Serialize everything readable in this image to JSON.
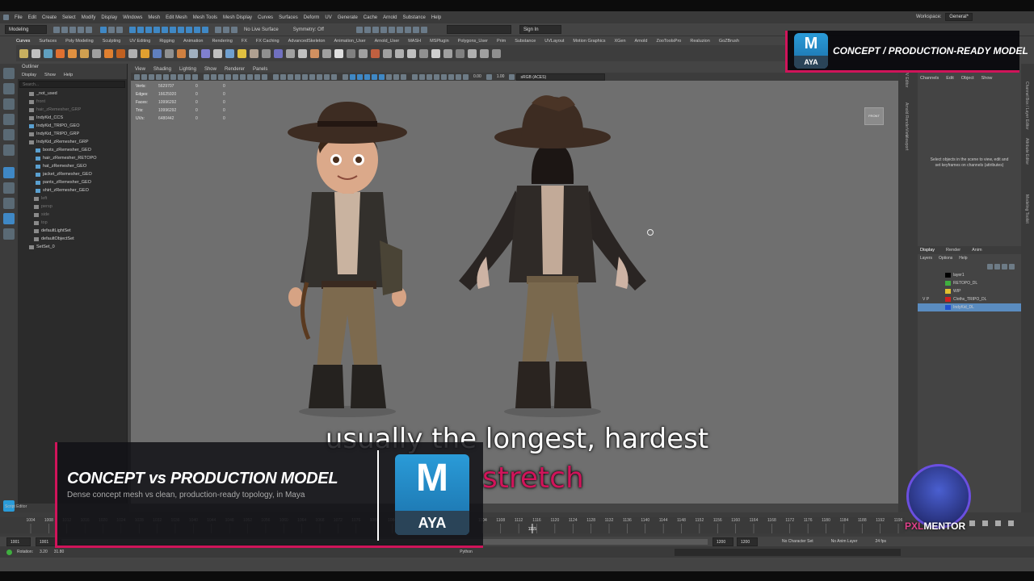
{
  "menubar": {
    "items": [
      "File",
      "Edit",
      "Create",
      "Select",
      "Modify",
      "Display",
      "Windows",
      "Mesh",
      "Edit Mesh",
      "Mesh Tools",
      "Mesh Display",
      "Curves",
      "Surfaces",
      "Deform",
      "UV",
      "Generate",
      "Cache",
      "Arnold",
      "Substance",
      "Help"
    ],
    "workspace_label": "Workspace:",
    "workspace_value": "General*"
  },
  "statusline": {
    "mode": "Modeling",
    "no_live_surface": "No Live Surface",
    "symmetry": "Symmetry: Off",
    "sign_in": "Sign In"
  },
  "shelf_tabs": [
    "Curves",
    "Surfaces",
    "Poly Modeling",
    "Sculpting",
    "UV Editing",
    "Rigging",
    "Animation",
    "Rendering",
    "FX",
    "FX Caching",
    "AdvancedSkeleton",
    "Animation_User",
    "Arnold_User",
    "MASH",
    "MSPlugin",
    "Polygons_User",
    "Prim",
    "Substance",
    "UVLayout",
    "Motion Graphics",
    "XGen",
    "Arnold",
    "ZooToolsPro",
    "Realuzion",
    "GoZBrush"
  ],
  "outliner": {
    "title": "Outliner",
    "menu": [
      "Display",
      "Show",
      "Help"
    ],
    "search_placeholder": "Search...",
    "nodes": [
      {
        "label": "_not_used",
        "dim": false
      },
      {
        "label": "front",
        "dim": true
      },
      {
        "label": "hair_zRemesher_GRP",
        "dim": true
      },
      {
        "label": "IndyKid_CCS",
        "dim": false
      },
      {
        "label": "IndyKid_TRIPO_GEO",
        "dim": false
      },
      {
        "label": "IndyKid_TRIPO_GRP",
        "dim": false
      },
      {
        "label": "IndyKid_zRemesher_GRP",
        "dim": false
      },
      {
        "label": "boots_zRemesher_GEO",
        "dim": false
      },
      {
        "label": "hair_zRemesher_RETOPO",
        "dim": false
      },
      {
        "label": "hat_zRemesher_GEO",
        "dim": false
      },
      {
        "label": "jacket_zRemesher_GEO",
        "dim": false
      },
      {
        "label": "pants_zRemesher_GEO",
        "dim": false
      },
      {
        "label": "shirt_zRemesher_GEO",
        "dim": false
      },
      {
        "label": "left",
        "dim": true
      },
      {
        "label": "persp",
        "dim": true
      },
      {
        "label": "side",
        "dim": true
      },
      {
        "label": "top",
        "dim": true
      },
      {
        "label": "defaultLightSet",
        "dim": false
      },
      {
        "label": "defaultObjectSet",
        "dim": false
      },
      {
        "label": "SetSet_0",
        "dim": false
      }
    ]
  },
  "viewport": {
    "menu": [
      "View",
      "Shading",
      "Lighting",
      "Show",
      "Renderer",
      "Panels"
    ],
    "exposure": "0.00",
    "gamma": "1.00",
    "color_space": "sRGB (ACES)",
    "view_cube": "FRONT",
    "hud": [
      {
        "k": "Verts:",
        "v": "5629707",
        "a": "0",
        "b": "0"
      },
      {
        "k": "Edges:",
        "v": "16625920",
        "a": "0",
        "b": "0"
      },
      {
        "k": "Faces:",
        "v": "10996292",
        "a": "0",
        "b": "0"
      },
      {
        "k": "Tris:",
        "v": "10996292",
        "a": "0",
        "b": "0"
      },
      {
        "k": "UVs:",
        "v": "6480442",
        "a": "0",
        "b": "0"
      }
    ]
  },
  "right_side_labels": [
    "UV Editor",
    "Arnold RenderView",
    "Viewport"
  ],
  "channel_box": {
    "menu": [
      "Channels",
      "Edit",
      "Object",
      "Show"
    ],
    "hint": "Select objects in the scene to view, edit and set keyframes on channels (attributes)"
  },
  "right_tabs": [
    "Channel Box / Layer Editor",
    "Attribute Editor",
    "Modeling Toolkit"
  ],
  "layers": {
    "tabs": [
      "Display",
      "Render",
      "Anim"
    ],
    "menu": [
      "Layers",
      "Options",
      "Help"
    ],
    "rows": [
      {
        "vp": "",
        "name": "layer1",
        "color": "#000000",
        "sel": false
      },
      {
        "vp": "",
        "name": "RETOPO_DL",
        "color": "#3fae3f",
        "sel": false
      },
      {
        "vp": "",
        "name": "WIP",
        "color": "#e0c030",
        "sel": false
      },
      {
        "vp": "V  P",
        "name": "Cloths_TRIPO_DL",
        "color": "#d02020",
        "sel": false
      },
      {
        "vp": "",
        "name": "IndyKid_DL",
        "color": "#2050d0",
        "sel": true
      }
    ]
  },
  "timeline": {
    "ticks": [
      "1004",
      "1008",
      "1012",
      "1016",
      "1020",
      "1024",
      "1028",
      "1032",
      "1036",
      "1040",
      "1044",
      "1048",
      "1052",
      "1056",
      "1060",
      "1064",
      "1068",
      "1072",
      "1076",
      "1080",
      "1084",
      "1088",
      "1092",
      "1096",
      "1100",
      "1104",
      "1108",
      "1112",
      "1116",
      "1120",
      "1124",
      "1128",
      "1132",
      "1136",
      "1140",
      "1144",
      "1148",
      "1152",
      "1156",
      "1160",
      "1164",
      "1168",
      "1172",
      "1176",
      "1180",
      "1184",
      "1188",
      "1192",
      "1196"
    ],
    "current": "1115"
  },
  "rangebar": {
    "start": "1001",
    "start2": "1001",
    "end": "1200",
    "end2": "1200",
    "character_set": "No Character Set",
    "anim_layer": "No Anim Layer",
    "fps": "24 fps"
  },
  "cmdline": {
    "script_editor": "Script Editor",
    "rotation_label": "Rotation:",
    "rx": "3.20",
    "ry": "31.80",
    "lang": "Python"
  },
  "subtitle": {
    "line1": "usually the longest, hardest",
    "line2": "stretch"
  },
  "lower_third": {
    "title": "CONCEPT vs PRODUCTION MODEL",
    "subtitle": "Dense concept mesh vs clean, production-ready topology, in Maya"
  },
  "logo": {
    "letter": "M",
    "word": "AYA"
  },
  "top_banner": {
    "title": "CONCEPT / PRODUCTION-READY MODEL"
  },
  "pxl": {
    "px": "PXL",
    "mentor": "MENTOR"
  },
  "colors": {
    "accent": "#d0145a",
    "maya_blue": "#2a9bd8",
    "viewport_bg": "#6f6f6f"
  }
}
